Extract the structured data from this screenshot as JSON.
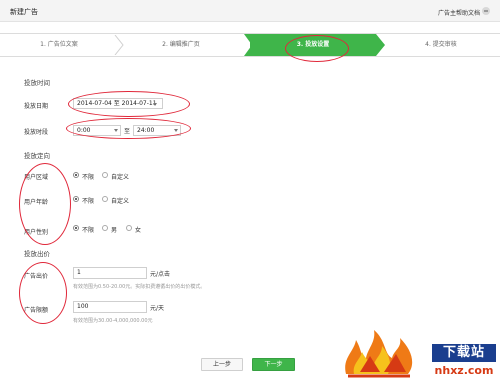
{
  "header": {
    "title": "新建广告",
    "help_text": "广告主帮助文档"
  },
  "steps": [
    {
      "label": "1. 广告位文案",
      "active": false
    },
    {
      "label": "2. 编辑推广页",
      "active": false
    },
    {
      "label": "3. 投放设置",
      "active": true
    },
    {
      "label": "4. 提交审核",
      "active": false
    }
  ],
  "schedule": {
    "section_title": "投放时间",
    "date_label": "投放日期",
    "date_range": "2014-07-04 至 2014-07-11",
    "time_label": "投放时段",
    "time_start": "0:00",
    "time_to": "至",
    "time_end": "24:00"
  },
  "targeting": {
    "section_title": "投放定向",
    "region": {
      "label": "用户区域",
      "options": [
        "不限",
        "自定义"
      ],
      "selected": "不限"
    },
    "age": {
      "label": "用户年龄",
      "options": [
        "不限",
        "自定义"
      ],
      "selected": "不限"
    },
    "gender": {
      "label": "用户性别",
      "options": [
        "不限",
        "男",
        "女"
      ],
      "selected": "不限"
    }
  },
  "bidding": {
    "section_title": "投放出价",
    "bid_label": "广告出价",
    "bid_value": "1",
    "bid_unit": "元/点击",
    "bid_hint": "有效范围为0.50-20.00元。实际扣费遵循出价的出价模式。",
    "budget_label": "广告限额",
    "budget_value": "100",
    "budget_unit": "元/天",
    "budget_hint": "有效范围为30.00-4,000,000.00元"
  },
  "actions": {
    "prev": "上一步",
    "next": "下一步"
  },
  "watermark": {
    "brand": "下载站",
    "url": "nhxz.com"
  },
  "colors": {
    "accent_green": "#3fb54a",
    "annotation_red": "#e0283a",
    "watermark_blue": "#1a3e8e",
    "watermark_orange": "#d63a14"
  },
  "icons": [
    "help-icon",
    "dropdown-caret-icon",
    "fire-logo-icon"
  ]
}
